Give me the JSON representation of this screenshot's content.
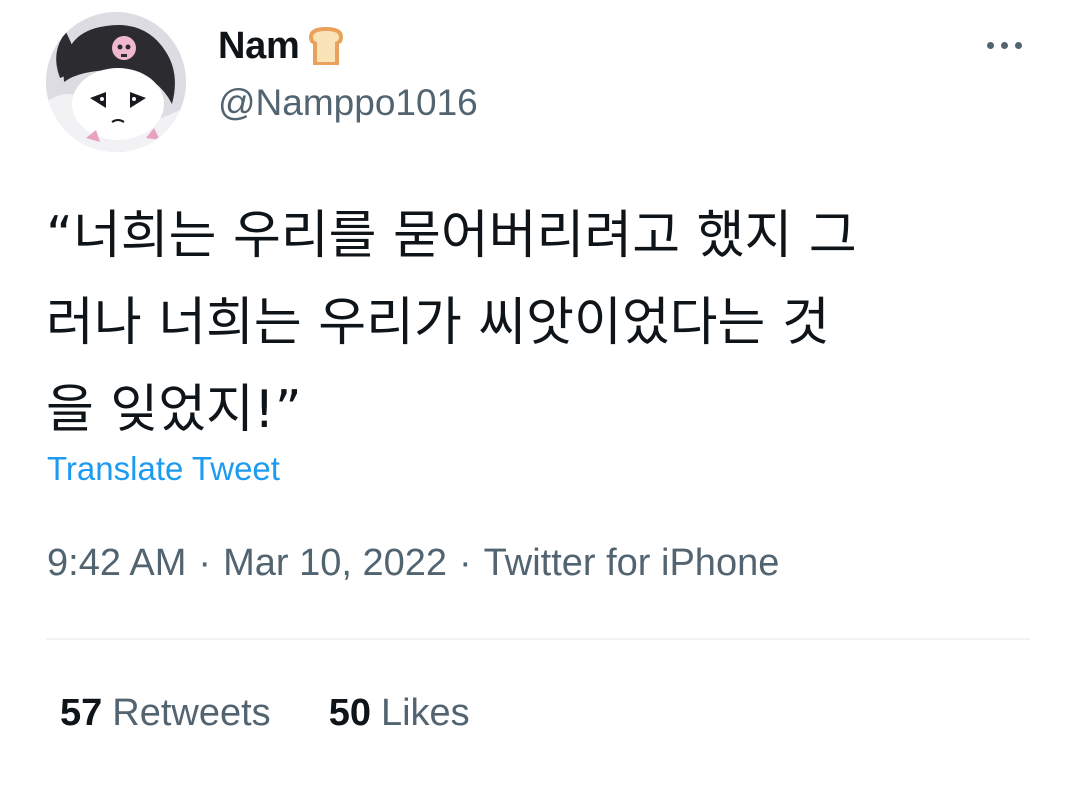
{
  "user": {
    "display_name": "Nam",
    "name_emoji": "bread-icon",
    "handle": "@Namppo1016",
    "avatar": "avatar-kuromi-icon"
  },
  "tweet": {
    "text_lines": [
      "“너희는 우리를 묻어버리려고 했지 그",
      "러나 너희는 우리가 씨앗이었다는 것",
      "을 잊었지!”"
    ]
  },
  "translate_label": "Translate Tweet",
  "meta": {
    "time": "9:42 AM",
    "separator": "·",
    "date": "Mar 10, 2022",
    "source": "Twitter for iPhone"
  },
  "stats": {
    "retweets_count": "57",
    "retweets_label": "Retweets",
    "likes_count": "50",
    "likes_label": "Likes"
  },
  "colors": {
    "link": "#1d9bf0",
    "secondary": "#536471",
    "primary": "#0f1419",
    "divider": "#eff3f4"
  }
}
